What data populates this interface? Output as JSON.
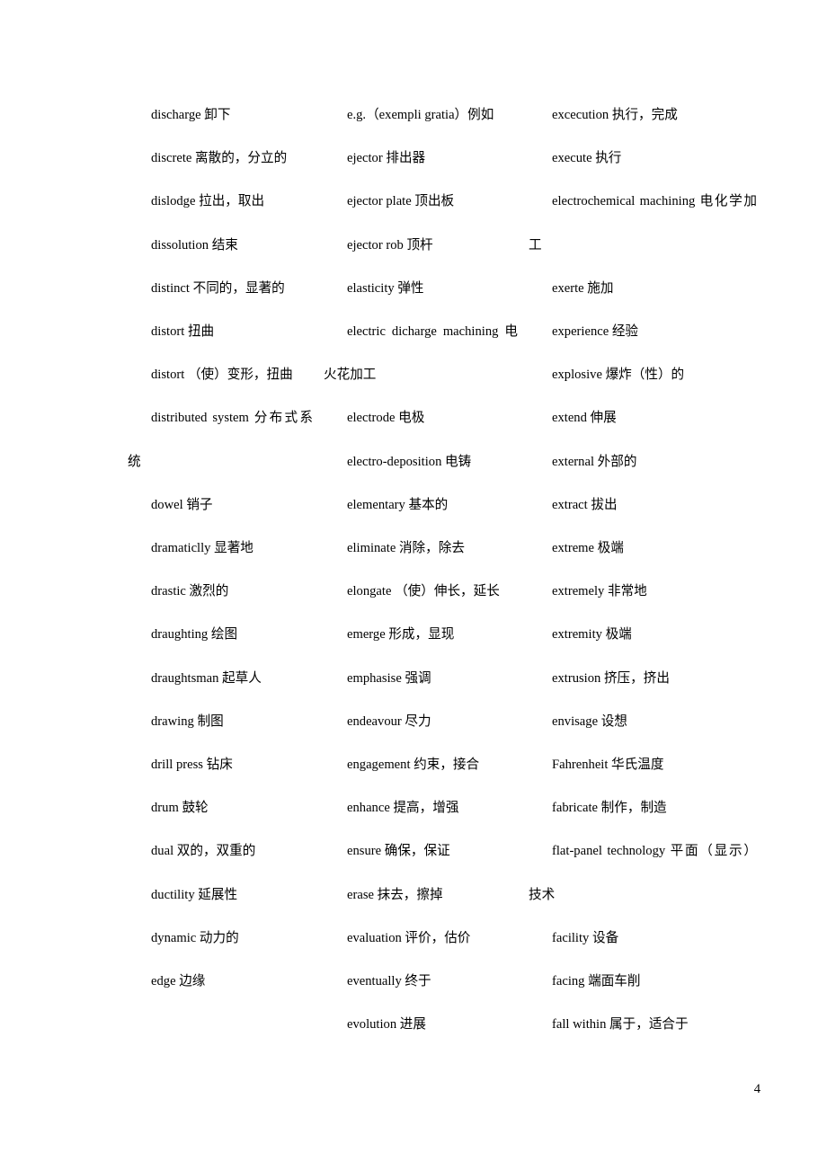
{
  "page": {
    "number": "4",
    "background": "#ffffff",
    "text_color": "#000000"
  },
  "columns": [
    {
      "id": "column-1",
      "entries": [
        "discharge  卸下",
        "discrete  离散的，分立的",
        "dislodge  拉出，取出",
        "dissolution  结束",
        "distinct  不同的，显著的",
        "distort  扭曲",
        "distort  （使）变形，扭曲",
        "distributed system  分布式系统",
        "dowel  销子",
        "dramaticlly  显著地",
        "drastic  激烈的",
        "draughting  绘图",
        "draughtsman  起草人",
        "drawing  制图",
        "drill press  钻床",
        "drum  鼓轮",
        "dual  双的，双重的",
        "ductility  延展性",
        "dynamic  动力的",
        "edge  边缘"
      ]
    },
    {
      "id": "column-2",
      "entries": [
        "e.g.（exempli gratia）例如",
        "ejector  排出器",
        "ejector plate  顶出板",
        "ejector rob  顶杆",
        "elasticity  弹性",
        "electric dicharge machining  电火花加工",
        "electrode  电极",
        "electro-deposition  电铸",
        "elementary  基本的",
        "eliminate  消除，除去",
        "elongate  （使）伸长，延长",
        "emerge  形成，显现",
        "emphasise  强调",
        "endeavour  尽力",
        "engagement  约束，接合",
        "enhance  提高，增强",
        "ensure  确保，保证",
        "erase  抹去，擦掉",
        "evaluation  评价，估价",
        "eventually  终于",
        "evolution  进展"
      ]
    },
    {
      "id": "column-3",
      "entries": [
        "excecution  执行，完成",
        "execute  执行",
        "electrochemical machining  电化学加工",
        "exerte  施加",
        "experience  经验",
        "explosive  爆炸（性）的",
        "extend  伸展",
        "external  外部的",
        "extract  拔出",
        "extreme  极端",
        "extremely  非常地",
        "extremity  极端",
        "extrusion  挤压，挤出",
        "envisage  设想",
        "Fahrenheit  华氏温度",
        "fabricate  制作，制造",
        "flat-panel technology  平面（显示）技术",
        "facility  设备",
        "facing  端面车削",
        "fall within  属于，适合于"
      ]
    }
  ]
}
